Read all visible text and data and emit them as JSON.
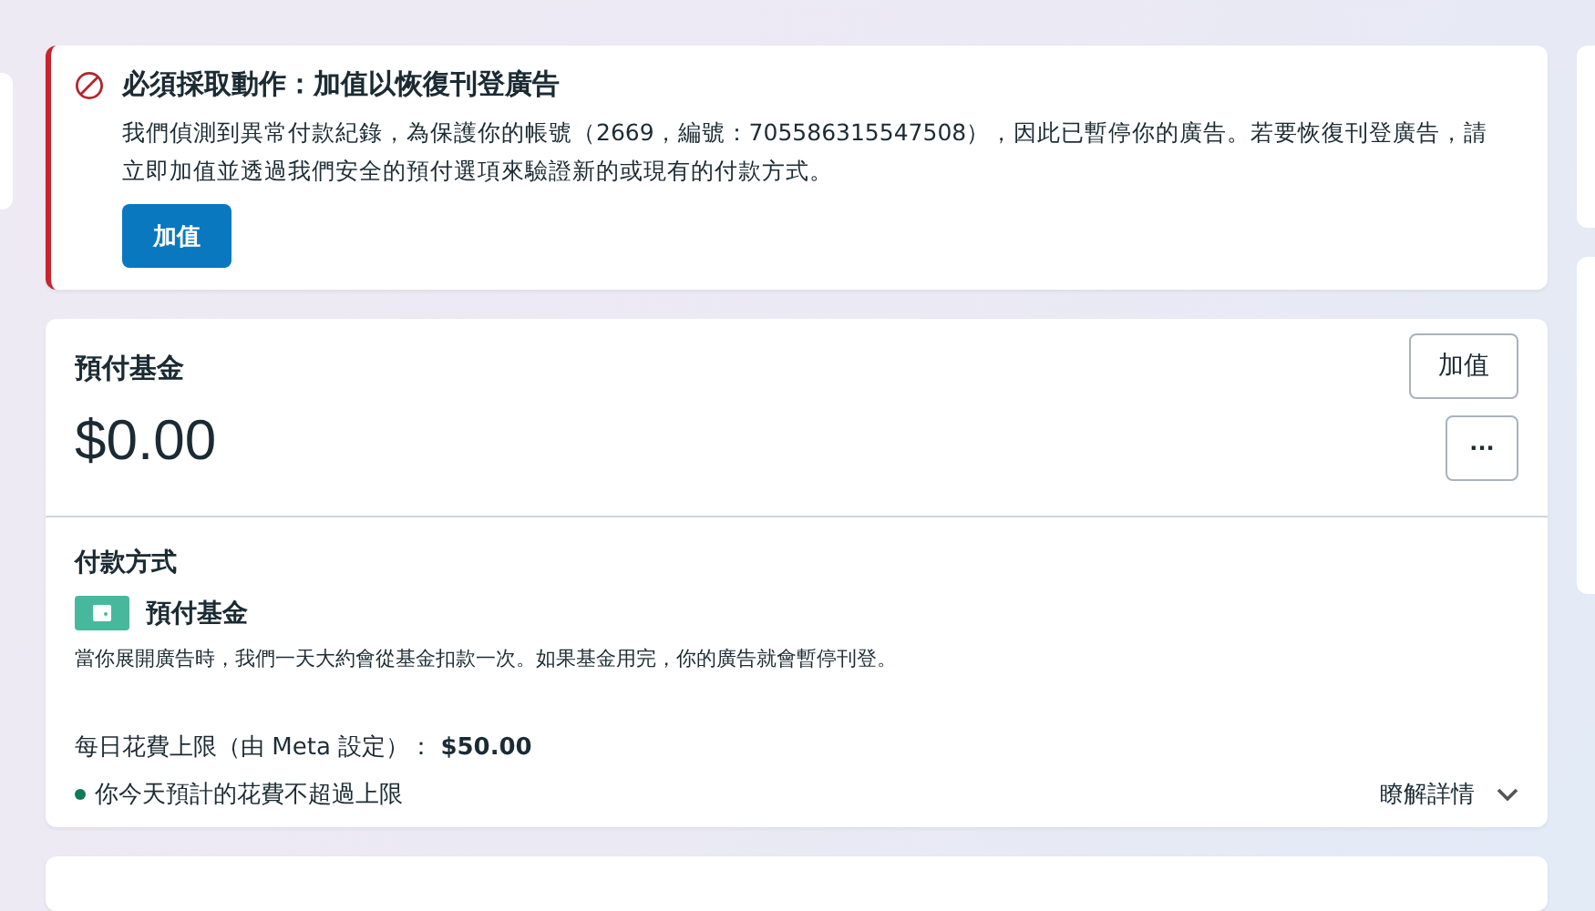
{
  "alert": {
    "title": "必須採取動作：加值以恢復刊登廣告",
    "body": "我們偵測到異常付款紀錄，為保護你的帳號（2669，編號：705586315547508），因此已暫停你的廣告。若要恢復刊登廣告，請立即加值並透過我們安全的預付選項來驗證新的或現有的付款方式。",
    "button": "加值"
  },
  "funds": {
    "title": "預付基金",
    "balance": "$0.00",
    "add_button": "加值",
    "more_button": "···"
  },
  "payment": {
    "title": "付款方式",
    "method": "預付基金",
    "description": "當你展開廣告時，我們一天大約會從基金扣款一次。如果基金用完，你的廣告就會暫停刊登。",
    "limit": "每日花費上限（由 Meta 設定）： **$50.00**",
    "status": {
      "text": "你今天預計的花費不超過上限",
      "color": "#0f7a5a"
    },
    "learn_more": {
      "label": "瞭解詳情",
      "expanded": false
    }
  }
}
